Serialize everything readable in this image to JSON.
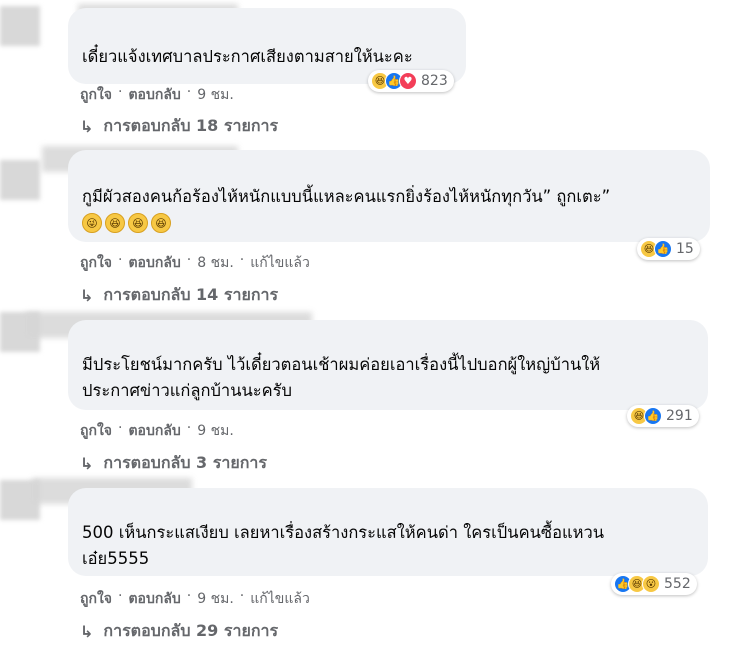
{
  "comments": [
    {
      "text": "เดี๋ยวแจ้งเทศบาลประกาศเสียงตามสายให้นะคะ",
      "emojis": [],
      "reaction_icons": [
        "haha-icon",
        "like-icon",
        "love-icon"
      ],
      "reaction_count": "823",
      "like": "ถูกใจ",
      "dot1": "·",
      "reply": "ตอบกลับ",
      "dot2": "·",
      "time": "9 ชม.",
      "edited": "",
      "replies_label": "การตอบกลับ 18 รายการ"
    },
    {
      "name_partial": "Chanong Sancha",
      "text": "กูมีผัวสองคนก้อร้องไห้หนักแบบนี้แหละคนแรกยิ่งร้องไห้หนักทุกวัน” ถูกเตะ”",
      "emojis": [
        "😜",
        "😆",
        "😆",
        "😆"
      ],
      "reaction_icons": [
        "haha-icon",
        "like-icon"
      ],
      "reaction_count": "15",
      "like": "ถูกใจ",
      "dot1": "·",
      "reply": "ตอบกลับ",
      "dot2": "·",
      "time": "8 ชม.",
      "dot3": "·",
      "edited": "แก้ไขแล้ว",
      "replies_label": "การตอบกลับ 14 รายการ"
    },
    {
      "text": "มีประโยชน์มากครับ ไว้เดี๋ยวตอนเช้าผมค่อยเอาเรื่องนี้ไปบอกผู้ใหญ่บ้านให้\nประกาศข่าวแก่ลูกบ้านนะครับ",
      "emojis": [],
      "reaction_icons": [
        "haha-icon",
        "like-icon"
      ],
      "reaction_count": "291",
      "like": "ถูกใจ",
      "dot1": "·",
      "reply": "ตอบกลับ",
      "dot2": "·",
      "time": "9 ชม.",
      "edited": "",
      "replies_label": "การตอบกลับ 3 รายการ"
    },
    {
      "text": "500 เห็นกระแสเงียบ เลยหาเรื่องสร้างกระแสให้คนด่า ใครเป็นคนซื้อแหวน\nเอ๋ย5555",
      "emojis": [],
      "reaction_icons": [
        "like-icon",
        "haha-icon",
        "wow-icon"
      ],
      "reaction_count": "552",
      "like": "ถูกใจ",
      "dot1": "·",
      "reply": "ตอบกลับ",
      "dot2": "·",
      "time": "9 ชม.",
      "dot3": "·",
      "edited": "แก้ไขแล้ว",
      "replies_label": "การตอบกลับ 29 รายการ"
    }
  ],
  "reply_arrow": "↳"
}
